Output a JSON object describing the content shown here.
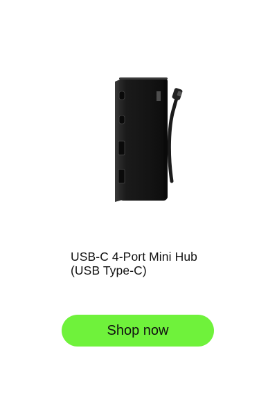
{
  "product": {
    "title_line1": "USB-C 4-Port Mini Hub",
    "title_line2": "(USB Type-C)",
    "image_icon": "usb-hub-product-photo"
  },
  "cta": {
    "label": "Shop now",
    "color": "#6ff23b"
  }
}
